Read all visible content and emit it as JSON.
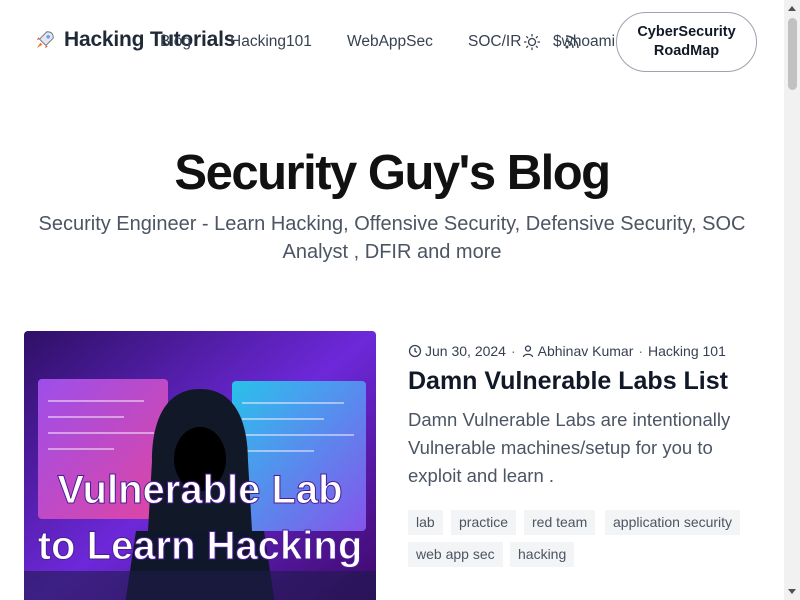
{
  "header": {
    "brand_name": "Hacking Tutorials",
    "brand_icon": "rocket-icon",
    "nav": {
      "blog": "Blog",
      "hacking101": "Hacking101",
      "webappsec": "WebAppSec",
      "socir": "SOC/IR",
      "whoami": "$whoami"
    },
    "theme_icon": "sun-icon",
    "rss_icon": "rss-icon",
    "roadmap_button": "CyberSecurity RoadMap"
  },
  "hero": {
    "title": "Security Guy's Blog",
    "subtitle": "Security Engineer - Learn Hacking, Offensive Security, Defensive Security, SOC Analyst , DFIR and more"
  },
  "post": {
    "date": "Jun 30, 2024",
    "author": "Abhinav Kumar",
    "category": "Hacking 101",
    "title": "Damn Vulnerable Labs List",
    "excerpt": "Damn Vulnerable Labs are intentionally Vulnerable machines/setup for you to exploit and learn .",
    "image_text_line1": "Vulnerable Lab",
    "image_text_line2": "to Learn Hacking",
    "tags": [
      "lab",
      "practice",
      "red team",
      "application security",
      "web app sec",
      "hacking"
    ]
  },
  "colors": {
    "text": "#111827",
    "muted": "#4b5563",
    "tag_bg": "#f3f4f6",
    "image_purple": "#7c3aed",
    "image_pink": "#ec4899",
    "image_cyan": "#22d3ee"
  }
}
